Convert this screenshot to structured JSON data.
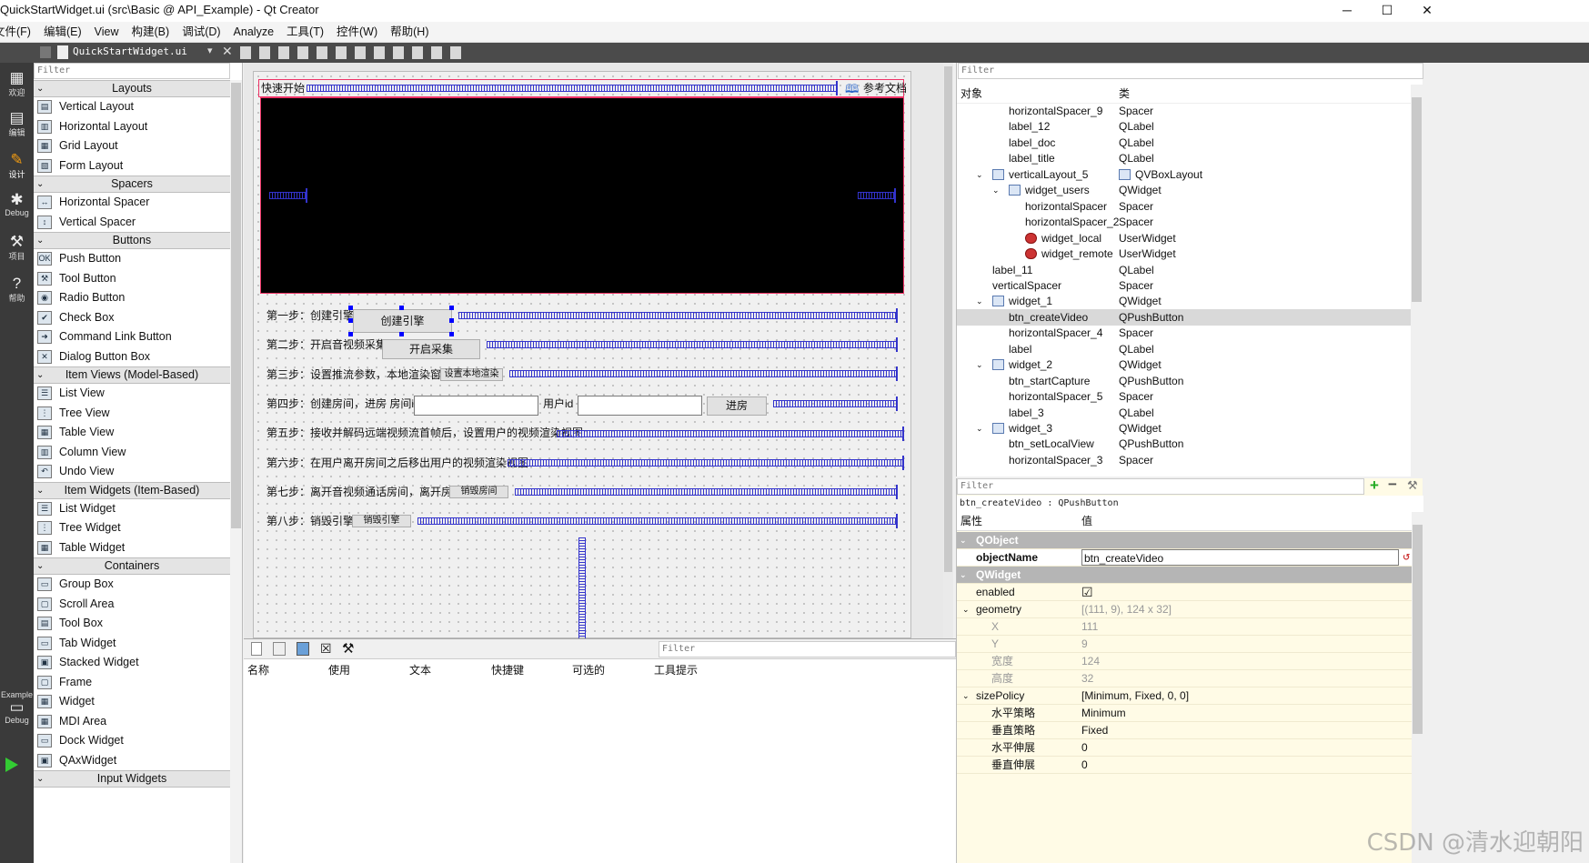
{
  "window": {
    "title": "QuickStartWidget.ui (src\\Basic @ API_Example) - Qt Creator",
    "minimize": "─",
    "maximize": "☐",
    "close": "✕"
  },
  "menu": [
    "文件(F)",
    "编辑(E)",
    "View",
    "构建(B)",
    "调试(D)",
    "Analyze",
    "工具(T)",
    "控件(W)",
    "帮助(H)"
  ],
  "toolbar": {
    "file": "QuickStartWidget.ui"
  },
  "modes": [
    "欢迎",
    "编辑",
    "设计",
    "Debug",
    "项目",
    "帮助",
    "Example",
    "Debug"
  ],
  "widgetbox": {
    "filter": "Filter",
    "sections": [
      {
        "title": "Layouts",
        "items": [
          "Vertical Layout",
          "Horizontal Layout",
          "Grid Layout",
          "Form Layout"
        ]
      },
      {
        "title": "Spacers",
        "items": [
          "Horizontal Spacer",
          "Vertical Spacer"
        ]
      },
      {
        "title": "Buttons",
        "items": [
          "Push Button",
          "Tool Button",
          "Radio Button",
          "Check Box",
          "Command Link Button",
          "Dialog Button Box"
        ]
      },
      {
        "title": "Item Views (Model-Based)",
        "items": [
          "List View",
          "Tree View",
          "Table View",
          "Column View",
          "Undo View"
        ]
      },
      {
        "title": "Item Widgets (Item-Based)",
        "items": [
          "List Widget",
          "Tree Widget",
          "Table Widget"
        ]
      },
      {
        "title": "Containers",
        "items": [
          "Group Box",
          "Scroll Area",
          "Tool Box",
          "Tab Widget",
          "Stacked Widget",
          "Frame",
          "Widget",
          "MDI Area",
          "Dock Widget",
          "QAxWidget"
        ]
      },
      {
        "title": "Input Widgets",
        "items": []
      }
    ]
  },
  "form": {
    "title_label": "快速开始",
    "doc_label": "参考文档",
    "step1": "第一步：创建引擎",
    "btn1": "创建引擎",
    "step2": "第二步：开启音视频采集",
    "btn2": "开启采集",
    "step3": "第三步：设置推流参数，本地渲染窗口",
    "btn3": "设置本地渲染",
    "step4": "第四步：创建房间，进房 房间id",
    "user_id": "用户id",
    "btn4": "进房",
    "step5": "第五步：接收并解码远端视频流首帧后，设置用户的视频渲染视图",
    "step6": "第六步：在用户离开房间之后移出用户的视频渲染视图",
    "step7": "第七步：离开音视频通话房间，离开房间",
    "btn7": "销毁房间",
    "step8": "第八步：销毁引擎",
    "btn8": "销毁引擎"
  },
  "actions": {
    "filter": "Filter",
    "columns": [
      "名称",
      "使用",
      "文本",
      "快捷键",
      "可选的",
      "工具提示"
    ]
  },
  "objects": {
    "filter": "Filter",
    "col_object": "对象",
    "col_class": "类",
    "rows": [
      {
        "name": "horizontalSpacer_9",
        "cls": "Spacer"
      },
      {
        "name": "label_12",
        "cls": "QLabel"
      },
      {
        "name": "label_doc",
        "cls": "QLabel"
      },
      {
        "name": "label_title",
        "cls": "QLabel"
      },
      {
        "name": "verticalLayout_5",
        "cls": "QVBoxLayout"
      },
      {
        "name": "widget_users",
        "cls": "QWidget"
      },
      {
        "name": "horizontalSpacer",
        "cls": "Spacer"
      },
      {
        "name": "horizontalSpacer_2",
        "cls": "Spacer"
      },
      {
        "name": "widget_local",
        "cls": "UserWidget"
      },
      {
        "name": "widget_remote",
        "cls": "UserWidget"
      },
      {
        "name": "label_11",
        "cls": "QLabel"
      },
      {
        "name": "verticalSpacer",
        "cls": "Spacer"
      },
      {
        "name": "widget_1",
        "cls": "QWidget"
      },
      {
        "name": "btn_createVideo",
        "cls": "QPushButton"
      },
      {
        "name": "horizontalSpacer_4",
        "cls": "Spacer"
      },
      {
        "name": "label",
        "cls": "QLabel"
      },
      {
        "name": "widget_2",
        "cls": "QWidget"
      },
      {
        "name": "btn_startCapture",
        "cls": "QPushButton"
      },
      {
        "name": "horizontalSpacer_5",
        "cls": "Spacer"
      },
      {
        "name": "label_3",
        "cls": "QLabel"
      },
      {
        "name": "widget_3",
        "cls": "QWidget"
      },
      {
        "name": "btn_setLocalView",
        "cls": "QPushButton"
      },
      {
        "name": "horizontalSpacer_3",
        "cls": "Spacer"
      }
    ]
  },
  "props": {
    "filter": "Filter",
    "object": "btn_createVideo : QPushButton",
    "col_prop": "属性",
    "col_val": "值",
    "qobject": "QObject",
    "objectName": "objectName",
    "objectName_val": "btn_createVideo",
    "qwidget": "QWidget",
    "enabled": "enabled",
    "enabled_val": "☑",
    "geometry": "geometry",
    "geometry_val": "[(111, 9), 124 x 32]",
    "x": "X",
    "x_val": "111",
    "y": "Y",
    "y_val": "9",
    "w": "宽度",
    "w_val": "124",
    "h": "高度",
    "h_val": "32",
    "sizePolicy": "sizePolicy",
    "sizePolicy_val": "[Minimum, Fixed, 0, 0]",
    "hpol": "水平策略",
    "hpol_val": "Minimum",
    "vpol": "垂直策略",
    "vpol_val": "Fixed",
    "hstretch": "水平伸展",
    "hstretch_val": "0",
    "vstretch": "垂直伸展",
    "vstretch_val": "0"
  },
  "watermark": "CSDN @清水迎朝阳"
}
